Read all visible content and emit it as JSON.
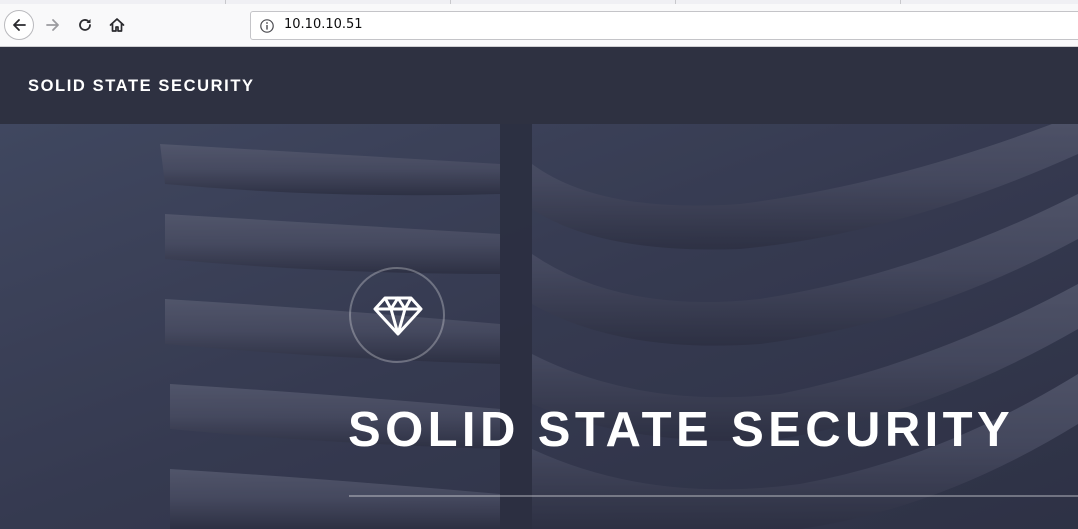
{
  "browser": {
    "url": "10.10.10.51",
    "icons": {
      "back": "arrow-left-icon",
      "forward": "arrow-right-icon",
      "reload": "reload-icon",
      "home": "home-icon",
      "site_info": "info-icon"
    }
  },
  "page": {
    "header": {
      "brand": "SOLID STATE SECURITY"
    },
    "banner": {
      "logo_icon": "diamond-icon",
      "title": "SOLID STATE SECURITY"
    },
    "colors": {
      "header_bg": "#2e3141",
      "banner_overlay": "#3b3f55",
      "text": "#ffffff"
    }
  }
}
